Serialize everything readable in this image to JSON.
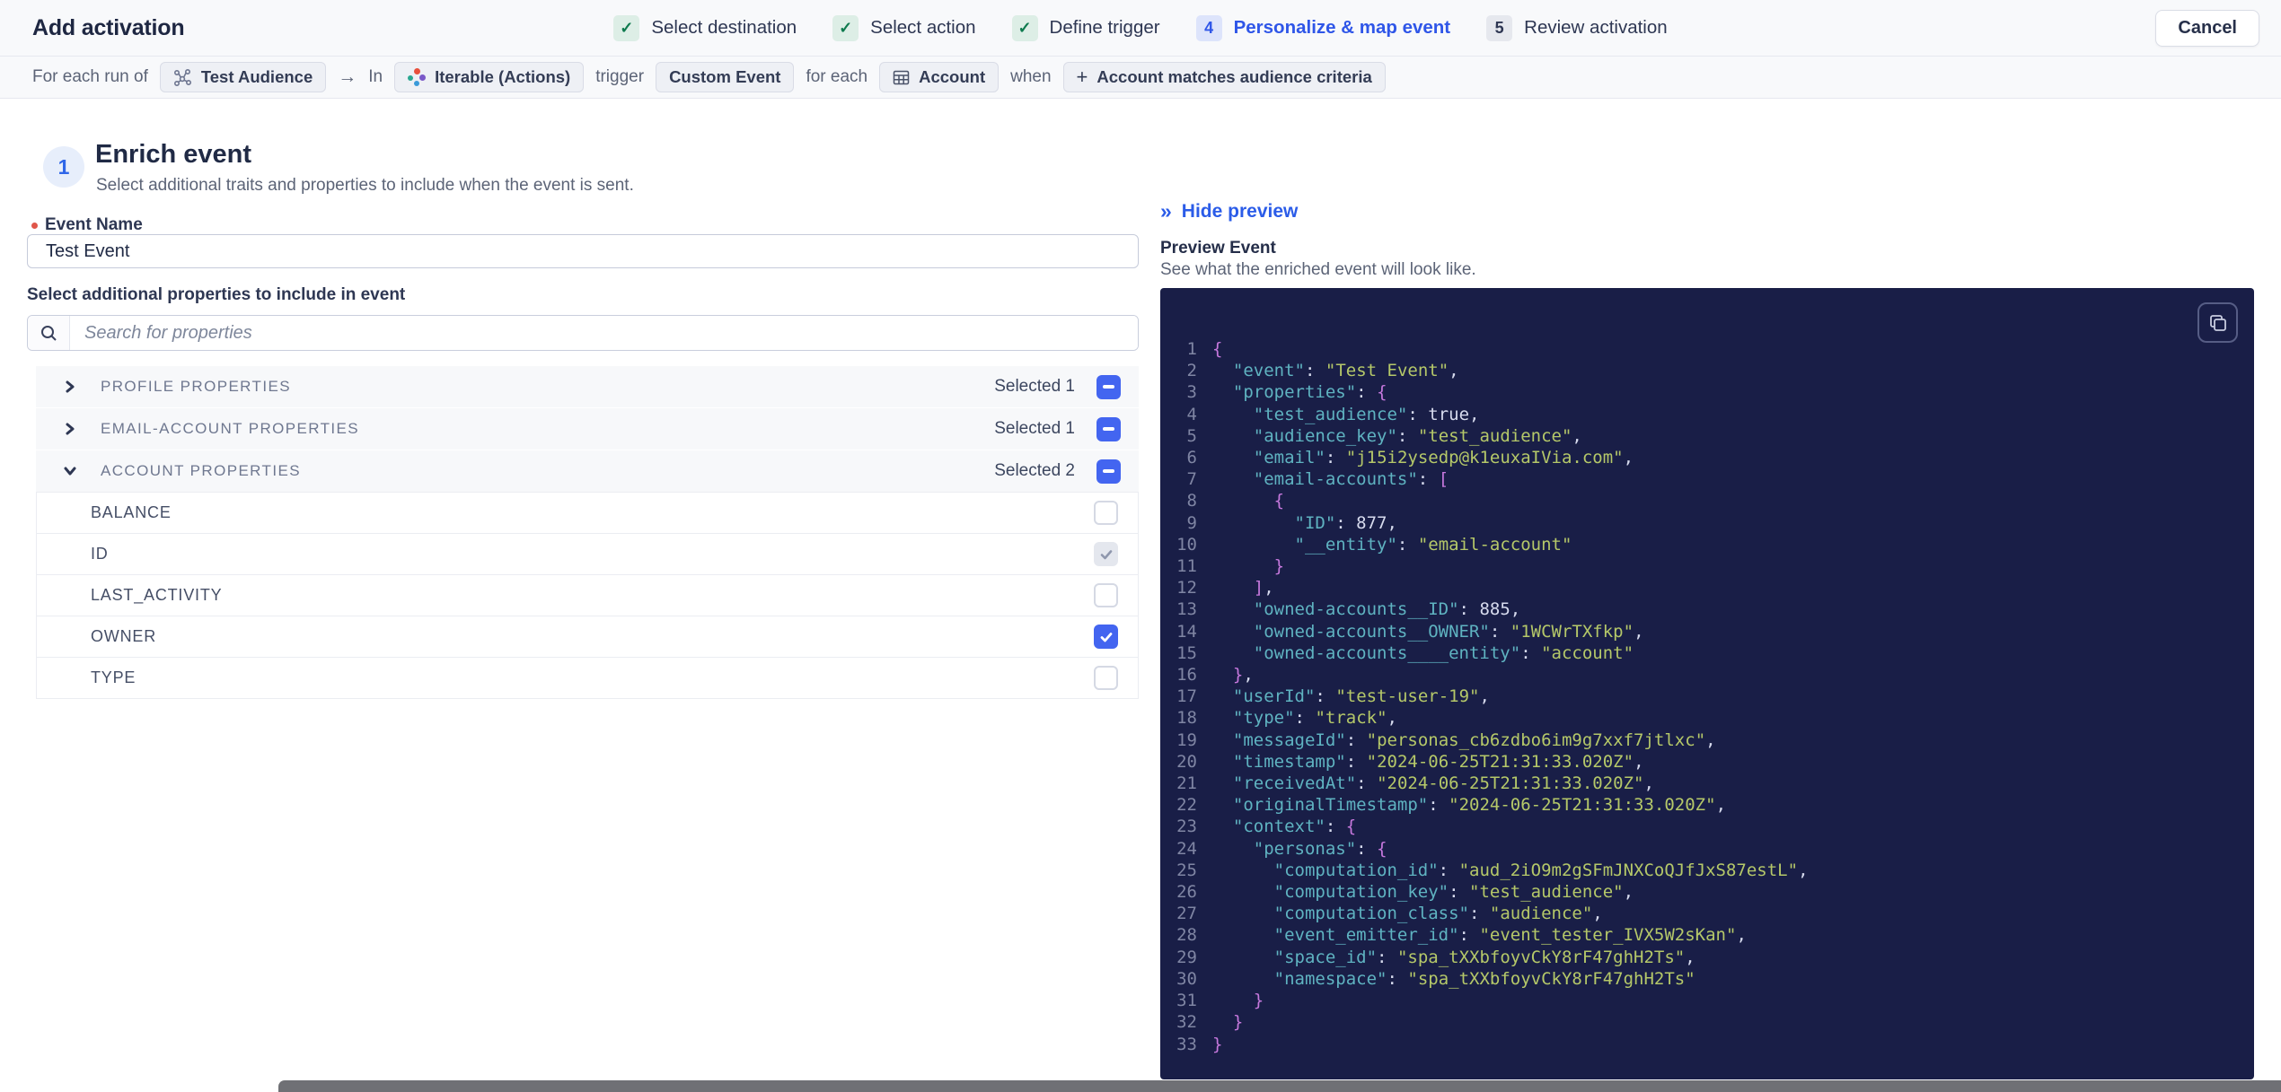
{
  "header": {
    "title": "Add activation",
    "cancel_label": "Cancel",
    "steps": [
      {
        "label": "Select destination",
        "state": "done"
      },
      {
        "label": "Select action",
        "state": "done"
      },
      {
        "label": "Define trigger",
        "state": "done"
      },
      {
        "label": "Personalize & map event",
        "state": "active",
        "number": "4"
      },
      {
        "label": "Review activation",
        "state": "todo",
        "number": "5"
      }
    ]
  },
  "context_bar": {
    "prefix": "For each run of",
    "audience_chip": "Test Audience",
    "in_label": "In",
    "destination_chip": "Iterable (Actions)",
    "trigger_label": "trigger",
    "trigger_chip": "Custom Event",
    "for_each_label": "for each",
    "entity_chip": "Account",
    "when_label": "when",
    "criteria_chip_label": "Account matches audience criteria"
  },
  "enrich": {
    "step_number": "1",
    "title": "Enrich event",
    "subtitle": "Select additional traits and properties to include when the event is sent.",
    "event_name_label": "Event Name",
    "event_name_value": "Test Event",
    "properties_label": "Select additional properties to include in event",
    "search_placeholder": "Search for properties",
    "groups": [
      {
        "label": "PROFILE PROPERTIES",
        "selected_text": "Selected 1",
        "expanded": false
      },
      {
        "label": "EMAIL-ACCOUNT PROPERTIES",
        "selected_text": "Selected 1",
        "expanded": false
      },
      {
        "label": "ACCOUNT PROPERTIES",
        "selected_text": "Selected 2",
        "expanded": true
      }
    ],
    "account_properties": [
      {
        "label": "BALANCE",
        "state": "unchecked"
      },
      {
        "label": "ID",
        "state": "checked-disabled"
      },
      {
        "label": "LAST_ACTIVITY",
        "state": "unchecked"
      },
      {
        "label": "OWNER",
        "state": "checked"
      },
      {
        "label": "TYPE",
        "state": "unchecked"
      }
    ]
  },
  "preview": {
    "hide_label": "Hide preview",
    "title": "Preview Event",
    "subtitle": "See what the enriched event will look like.",
    "code_lines": [
      "{",
      "  \"event\": \"Test Event\",",
      "  \"properties\": {",
      "    \"test_audience\": true,",
      "    \"audience_key\": \"test_audience\",",
      "    \"email\": \"j15i2ysedp@k1euxaIVia.com\",",
      "    \"email-accounts\": [",
      "      {",
      "        \"ID\": 877,",
      "        \"__entity\": \"email-account\"",
      "      }",
      "    ],",
      "    \"owned-accounts__ID\": 885,",
      "    \"owned-accounts__OWNER\": \"1WCWrTXfkp\",",
      "    \"owned-accounts____entity\": \"account\"",
      "  },",
      "  \"userId\": \"test-user-19\",",
      "  \"type\": \"track\",",
      "  \"messageId\": \"personas_cb6zdbo6im9g7xxf7jtlxc\",",
      "  \"timestamp\": \"2024-06-25T21:31:33.020Z\",",
      "  \"receivedAt\": \"2024-06-25T21:31:33.020Z\",",
      "  \"originalTimestamp\": \"2024-06-25T21:31:33.020Z\",",
      "  \"context\": {",
      "    \"personas\": {",
      "      \"computation_id\": \"aud_2iO9m2gSFmJNXCoQJfJxS87estL\",",
      "      \"computation_key\": \"test_audience\",",
      "      \"computation_class\": \"audience\",",
      "      \"event_emitter_id\": \"event_tester_IVX5W2sKan\",",
      "      \"space_id\": \"spa_tXXbfoyvCkY8rF47ghH2Ts\",",
      "      \"namespace\": \"spa_tXXbfoyvCkY8rF47ghH2Ts\"",
      "    }",
      "  }",
      "}"
    ]
  },
  "icons": {
    "check": "✓",
    "arrow_right": "→",
    "plus": "+",
    "double_chevron_right": "»"
  },
  "colors": {
    "accent_blue": "#2f56e8",
    "checkbox_blue": "#4365f0",
    "success_green": "#0e7a4e",
    "code_background": "#191e47",
    "syntax_key": "#5fb3c1",
    "syntax_string": "#b5c869",
    "syntax_number": "#e0795a",
    "syntax_boolean": "#e8566d",
    "syntax_brace": "#c678dd"
  }
}
